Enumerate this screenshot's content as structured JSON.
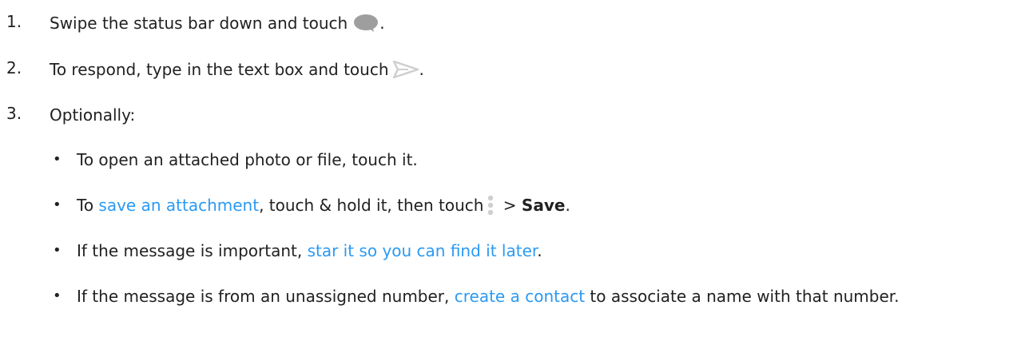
{
  "steps": [
    {
      "number": "1.",
      "text_before": "Swipe the status bar down and touch",
      "text_after": ".",
      "icon": "chat-bubble-icon"
    },
    {
      "number": "2.",
      "text_before": "To respond, type in the text box and touch",
      "text_after": ".",
      "icon": "send-icon"
    },
    {
      "number": "3.",
      "text": "Optionally:"
    }
  ],
  "bullets": [
    {
      "text": "To open an attached photo or file, touch it."
    },
    {
      "pre": "To ",
      "link": "save an attachment",
      "mid": ", touch & hold it, then touch",
      "sep": " > ",
      "bold": "Save",
      "end": ".",
      "icon": "more-vert-icon"
    },
    {
      "pre": "If the message is important, ",
      "link": "star it so you can find it later",
      "end": "."
    },
    {
      "pre": "If the message is from an unassigned number, ",
      "link": "create a contact",
      "end": " to associate a name with that number."
    }
  ],
  "bullet_char": "•",
  "colors": {
    "text": "#212121",
    "link": "#2b9af3",
    "icon_gray": "#9e9e9e",
    "icon_light": "#cfcfcf"
  }
}
